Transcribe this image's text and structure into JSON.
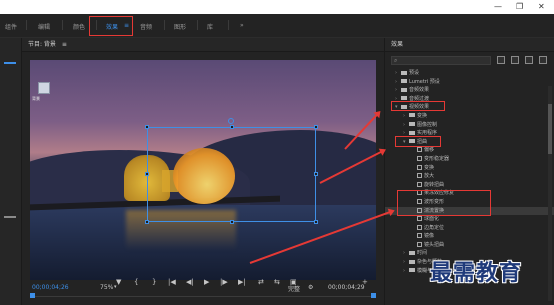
{
  "titlebar": {
    "minimize": "—",
    "maximize": "❐",
    "close": "✕"
  },
  "workspaces": [
    "组件",
    "编辑",
    "颜色",
    "效果",
    "音频",
    "图形",
    "库"
  ],
  "workspace_more": "»",
  "workspace_menu": "≡",
  "program_monitor": {
    "title": "节目: 背景",
    "menu": "≡",
    "desktop_icon_label": "背景",
    "timecode": "00;00;04;26",
    "zoom": "75%",
    "quality": "完整",
    "duration": "00;00;04;29"
  },
  "transport_buttons": [
    "▼",
    "{",
    "}",
    "|◀",
    "◀|",
    "▶",
    "|▶",
    "▶|",
    "⇄",
    "⇆",
    "▣",
    "+"
  ],
  "effects_panel": {
    "title": "效果",
    "menu": "≡",
    "items": [
      {
        "label": "预设",
        "kind": "folder",
        "level": 0
      },
      {
        "label": "Lumetri 预设",
        "kind": "folder",
        "level": 0
      },
      {
        "label": "音频效果",
        "kind": "folder",
        "level": 0
      },
      {
        "label": "音频过渡",
        "kind": "folder",
        "level": 0
      },
      {
        "label": "视频效果",
        "kind": "folder",
        "level": 0
      },
      {
        "label": "变换",
        "kind": "folder",
        "level": 1
      },
      {
        "label": "图像控制",
        "kind": "folder",
        "level": 1
      },
      {
        "label": "实用程序",
        "kind": "folder",
        "level": 1
      },
      {
        "label": "扭曲",
        "kind": "folder",
        "level": 1
      },
      {
        "label": "偏移",
        "kind": "effect",
        "level": 2
      },
      {
        "label": "变形稳定器",
        "kind": "effect",
        "level": 2
      },
      {
        "label": "变换",
        "kind": "effect",
        "level": 2
      },
      {
        "label": "放大",
        "kind": "effect",
        "level": 2
      },
      {
        "label": "旋转扭曲",
        "kind": "effect",
        "level": 2
      },
      {
        "label": "果冻效应修复",
        "kind": "effect",
        "level": 2
      },
      {
        "label": "波形变形",
        "kind": "effect",
        "level": 2
      },
      {
        "label": "湍流置换",
        "kind": "effect",
        "level": 2
      },
      {
        "label": "球面化",
        "kind": "effect",
        "level": 2
      },
      {
        "label": "边角定位",
        "kind": "effect",
        "level": 2
      },
      {
        "label": "镜像",
        "kind": "effect",
        "level": 2
      },
      {
        "label": "镜头扭曲",
        "kind": "effect",
        "level": 2
      },
      {
        "label": "时间",
        "kind": "folder",
        "level": 1
      },
      {
        "label": "杂色与颗粒",
        "kind": "folder",
        "level": 1
      },
      {
        "label": "模糊与锐化",
        "kind": "folder",
        "level": 1
      }
    ]
  },
  "watermark": "最需教育",
  "colors": {
    "accent": "#3d8fe8",
    "annotation": "#e53935"
  }
}
